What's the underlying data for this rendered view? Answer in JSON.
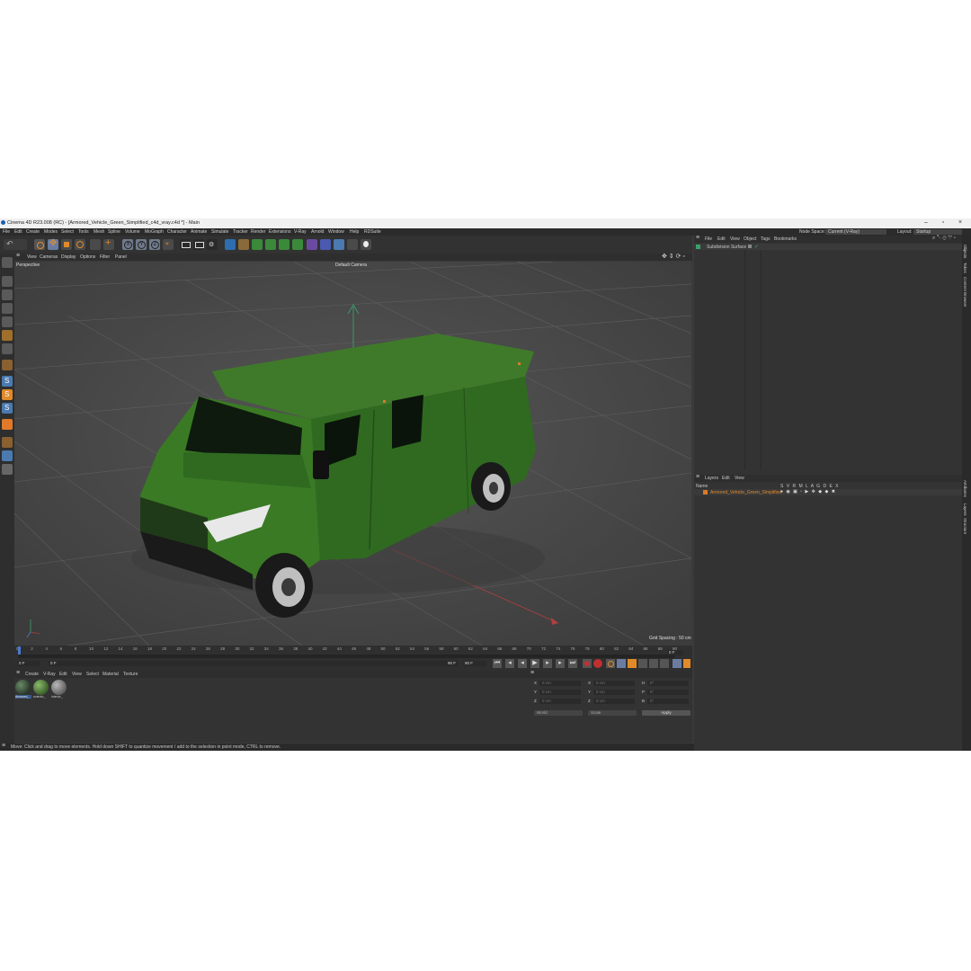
{
  "window": {
    "title": "Cinema 4D R23.008 (RC) - [Armored_Vehicle_Green_Simplified_c4d_vray.c4d *] - Main"
  },
  "menu": [
    "File",
    "Edit",
    "Create",
    "Modes",
    "Select",
    "Tools",
    "Mesh",
    "Spline",
    "Volume",
    "MoGraph",
    "Character",
    "Animate",
    "Simulate",
    "Tracker",
    "Render",
    "Extensions",
    "V-Ray",
    "Arnold",
    "Window",
    "Help",
    "RDSuite"
  ],
  "top_right": {
    "node_space_label": "Node Space:",
    "node_space_value": "Current (V-Ray)",
    "layout_label": "Layout:",
    "layout_value": "Startup"
  },
  "viewport_menu": [
    "View",
    "Cameras",
    "Display",
    "Options",
    "Filter",
    "Panel"
  ],
  "viewport": {
    "name": "Perspective",
    "camera": "Default Camera",
    "grid_spacing": "Grid Spacing : 50 cm"
  },
  "timeline": {
    "ticks": [
      "0",
      "2",
      "4",
      "6",
      "8",
      "10",
      "12",
      "14",
      "16",
      "18",
      "20",
      "22",
      "24",
      "26",
      "28",
      "30",
      "32",
      "34",
      "36",
      "38",
      "40",
      "42",
      "44",
      "46",
      "48",
      "50",
      "52",
      "54",
      "56",
      "58",
      "60",
      "62",
      "64",
      "66",
      "68",
      "70",
      "72",
      "74",
      "76",
      "78",
      "80",
      "82",
      "84",
      "86",
      "88",
      "90"
    ],
    "current_frame": "0 F",
    "start": "0 F",
    "start2": "0 F",
    "end": "90 F",
    "end2": "90 F",
    "frame_right": "0 F"
  },
  "material_menu": [
    "Create",
    "V-Ray",
    "Edit",
    "View",
    "Select",
    "Material",
    "Texture"
  ],
  "materials": [
    {
      "name": "Armored_",
      "color": "#1e2a1e"
    },
    {
      "name": "exterior_",
      "color": "#2f5a2a"
    },
    {
      "name": "interior_",
      "color": "#6a6a6a"
    }
  ],
  "coords": {
    "rows": [
      {
        "a": "X",
        "av": "0 cm",
        "b": "X",
        "bv": "0 cm",
        "c": "H",
        "cv": "0°"
      },
      {
        "a": "Y",
        "av": "0 cm",
        "b": "Y",
        "bv": "0 cm",
        "c": "P",
        "cv": "0°"
      },
      {
        "a": "Z",
        "av": "0 cm",
        "b": "Z",
        "bv": "0 cm",
        "c": "B",
        "cv": "0°"
      }
    ],
    "mode1": "World",
    "mode2": "Scale",
    "apply": "Apply"
  },
  "objects_menu": [
    "File",
    "Edit",
    "View",
    "Object",
    "Tags",
    "Bookmarks"
  ],
  "objects": [
    {
      "name": "Subdivision Surface"
    }
  ],
  "layers_menu": [
    "Layers",
    "Edit",
    "View"
  ],
  "layers_header": {
    "name": "Name",
    "flags": "S V R M L A G D E X"
  },
  "layers": [
    {
      "name": "Armored_Vehicle_Green_Simplified",
      "color": "#d97a2a"
    }
  ],
  "side_tabs_top": [
    "Objects",
    "Takes",
    "Content Browser"
  ],
  "side_tabs_bottom": [
    "Attributes",
    "Layers",
    "Structure"
  ],
  "status": "Move: Click and drag to move elements. Hold down SHIFT to quantize movement / add to the selection in point mode, CTRL to remove."
}
